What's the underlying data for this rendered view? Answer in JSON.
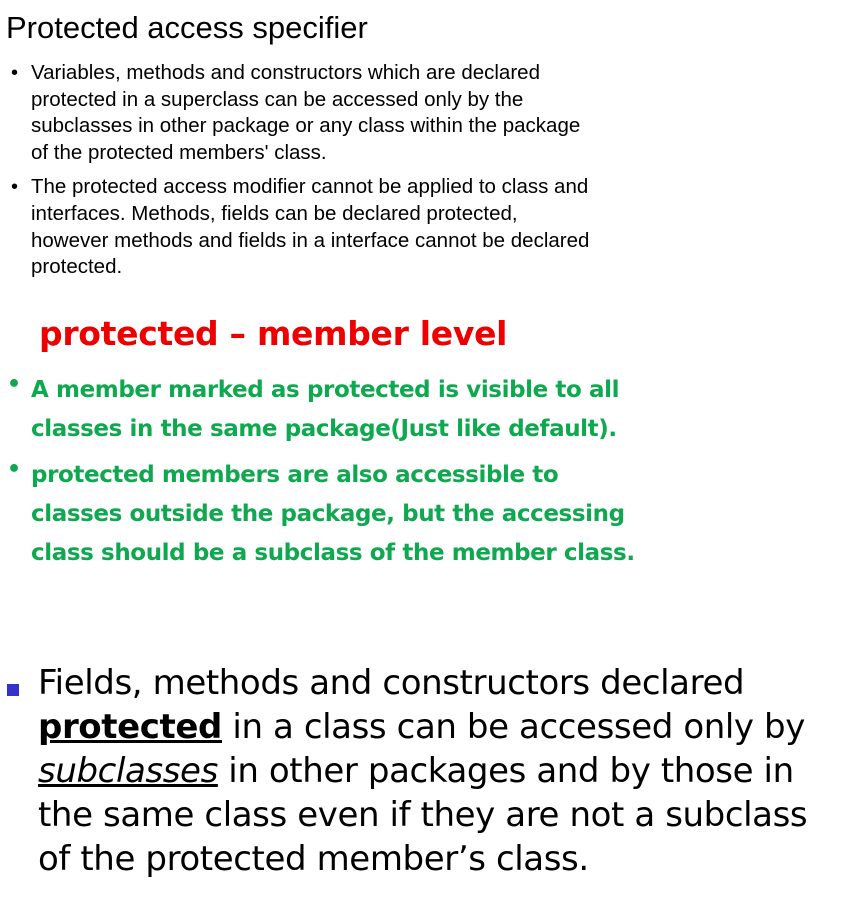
{
  "title": "Protected access specifier",
  "section1": {
    "bullet_glyph": "•",
    "items": [
      "Variables, methods and constructors which are declared protected in a superclass can be accessed only by the subclasses in other package or any class within the package of the protected members' class.",
      "The protected access modifier cannot be applied to class and interfaces. Methods, fields can be declared protected, however methods and fields in a interface cannot be declared protected."
    ]
  },
  "section2": {
    "heading": "protected – member level",
    "bullet_glyph": "•",
    "items": [
      "A member marked as protected is visible to all classes in the same package(Just like default).",
      "protected  members are also accessible to classes outside the package, but the accessing class should be a subclass of the member class."
    ],
    "text_color": "#0ea84f",
    "heading_color": "#ee0000"
  },
  "section3": {
    "part1": "Fields, methods and constructors declared ",
    "keyword": "protected",
    "part2": " in a class can be accessed only by ",
    "emphasis": "subclasses",
    "part3": " in other packages and by those in the same class even if they are not a subclass of the protected member’s class.",
    "bullet_color": "#3333cc"
  }
}
